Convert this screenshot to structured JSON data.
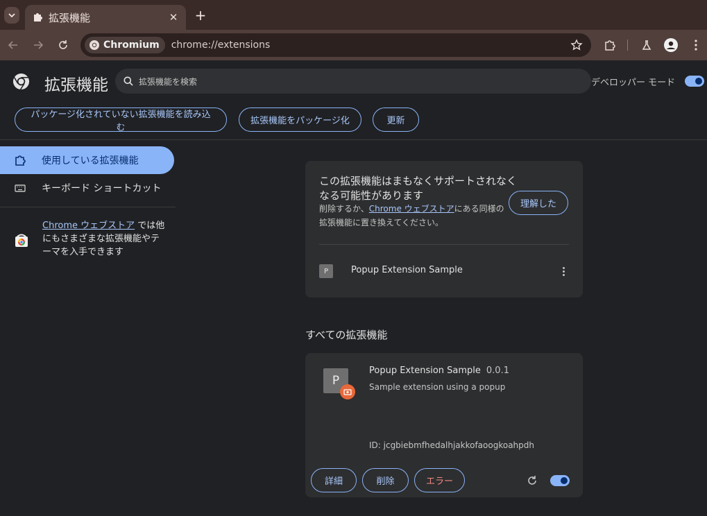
{
  "browser": {
    "tab_title": "拡張機能",
    "omnibox_chip": "Chromium",
    "url": "chrome://extensions"
  },
  "header": {
    "title": "拡張機能",
    "search_placeholder": "拡張機能を検索",
    "dev_mode_label": "デベロッパー モード",
    "dev_mode_on": true
  },
  "actions": {
    "load_unpacked": "パッケージ化されていない拡張機能を読み込む",
    "pack": "拡張機能をパッケージ化",
    "update": "更新"
  },
  "sidebar": {
    "items": [
      {
        "label": "使用している拡張機能",
        "active": true
      },
      {
        "label": "キーボード ショートカット",
        "active": false
      }
    ],
    "store_link": "Chrome ウェブストア",
    "store_suffix": " では他にもさまざまな拡張機能やテーマを入手できます"
  },
  "warning_card": {
    "title": "この拡張機能はまもなくサポートされなくなる可能性があります",
    "desc_prefix": "削除するか、",
    "desc_link": "Chrome ウェブストア",
    "desc_suffix": "にある同様の拡張機能に置き換えてください。",
    "ack_button": "理解した",
    "ext_letter": "P",
    "ext_name": "Popup Extension Sample"
  },
  "all_extensions": {
    "section_title": "すべての拡張機能",
    "ext_letter": "P",
    "name": "Popup Extension Sample",
    "version": "0.0.1",
    "description": "Sample extension using a popup",
    "id": "ID: jcgbiebmfhedalhjakkofaoogkoahpdh",
    "details_button": "詳細",
    "remove_button": "削除",
    "errors_button": "エラー",
    "enabled": true
  },
  "colors": {
    "accent": "#8ab4f8",
    "frame": "#513f3b",
    "error": "#f28b82",
    "badge": "#e8683a"
  }
}
